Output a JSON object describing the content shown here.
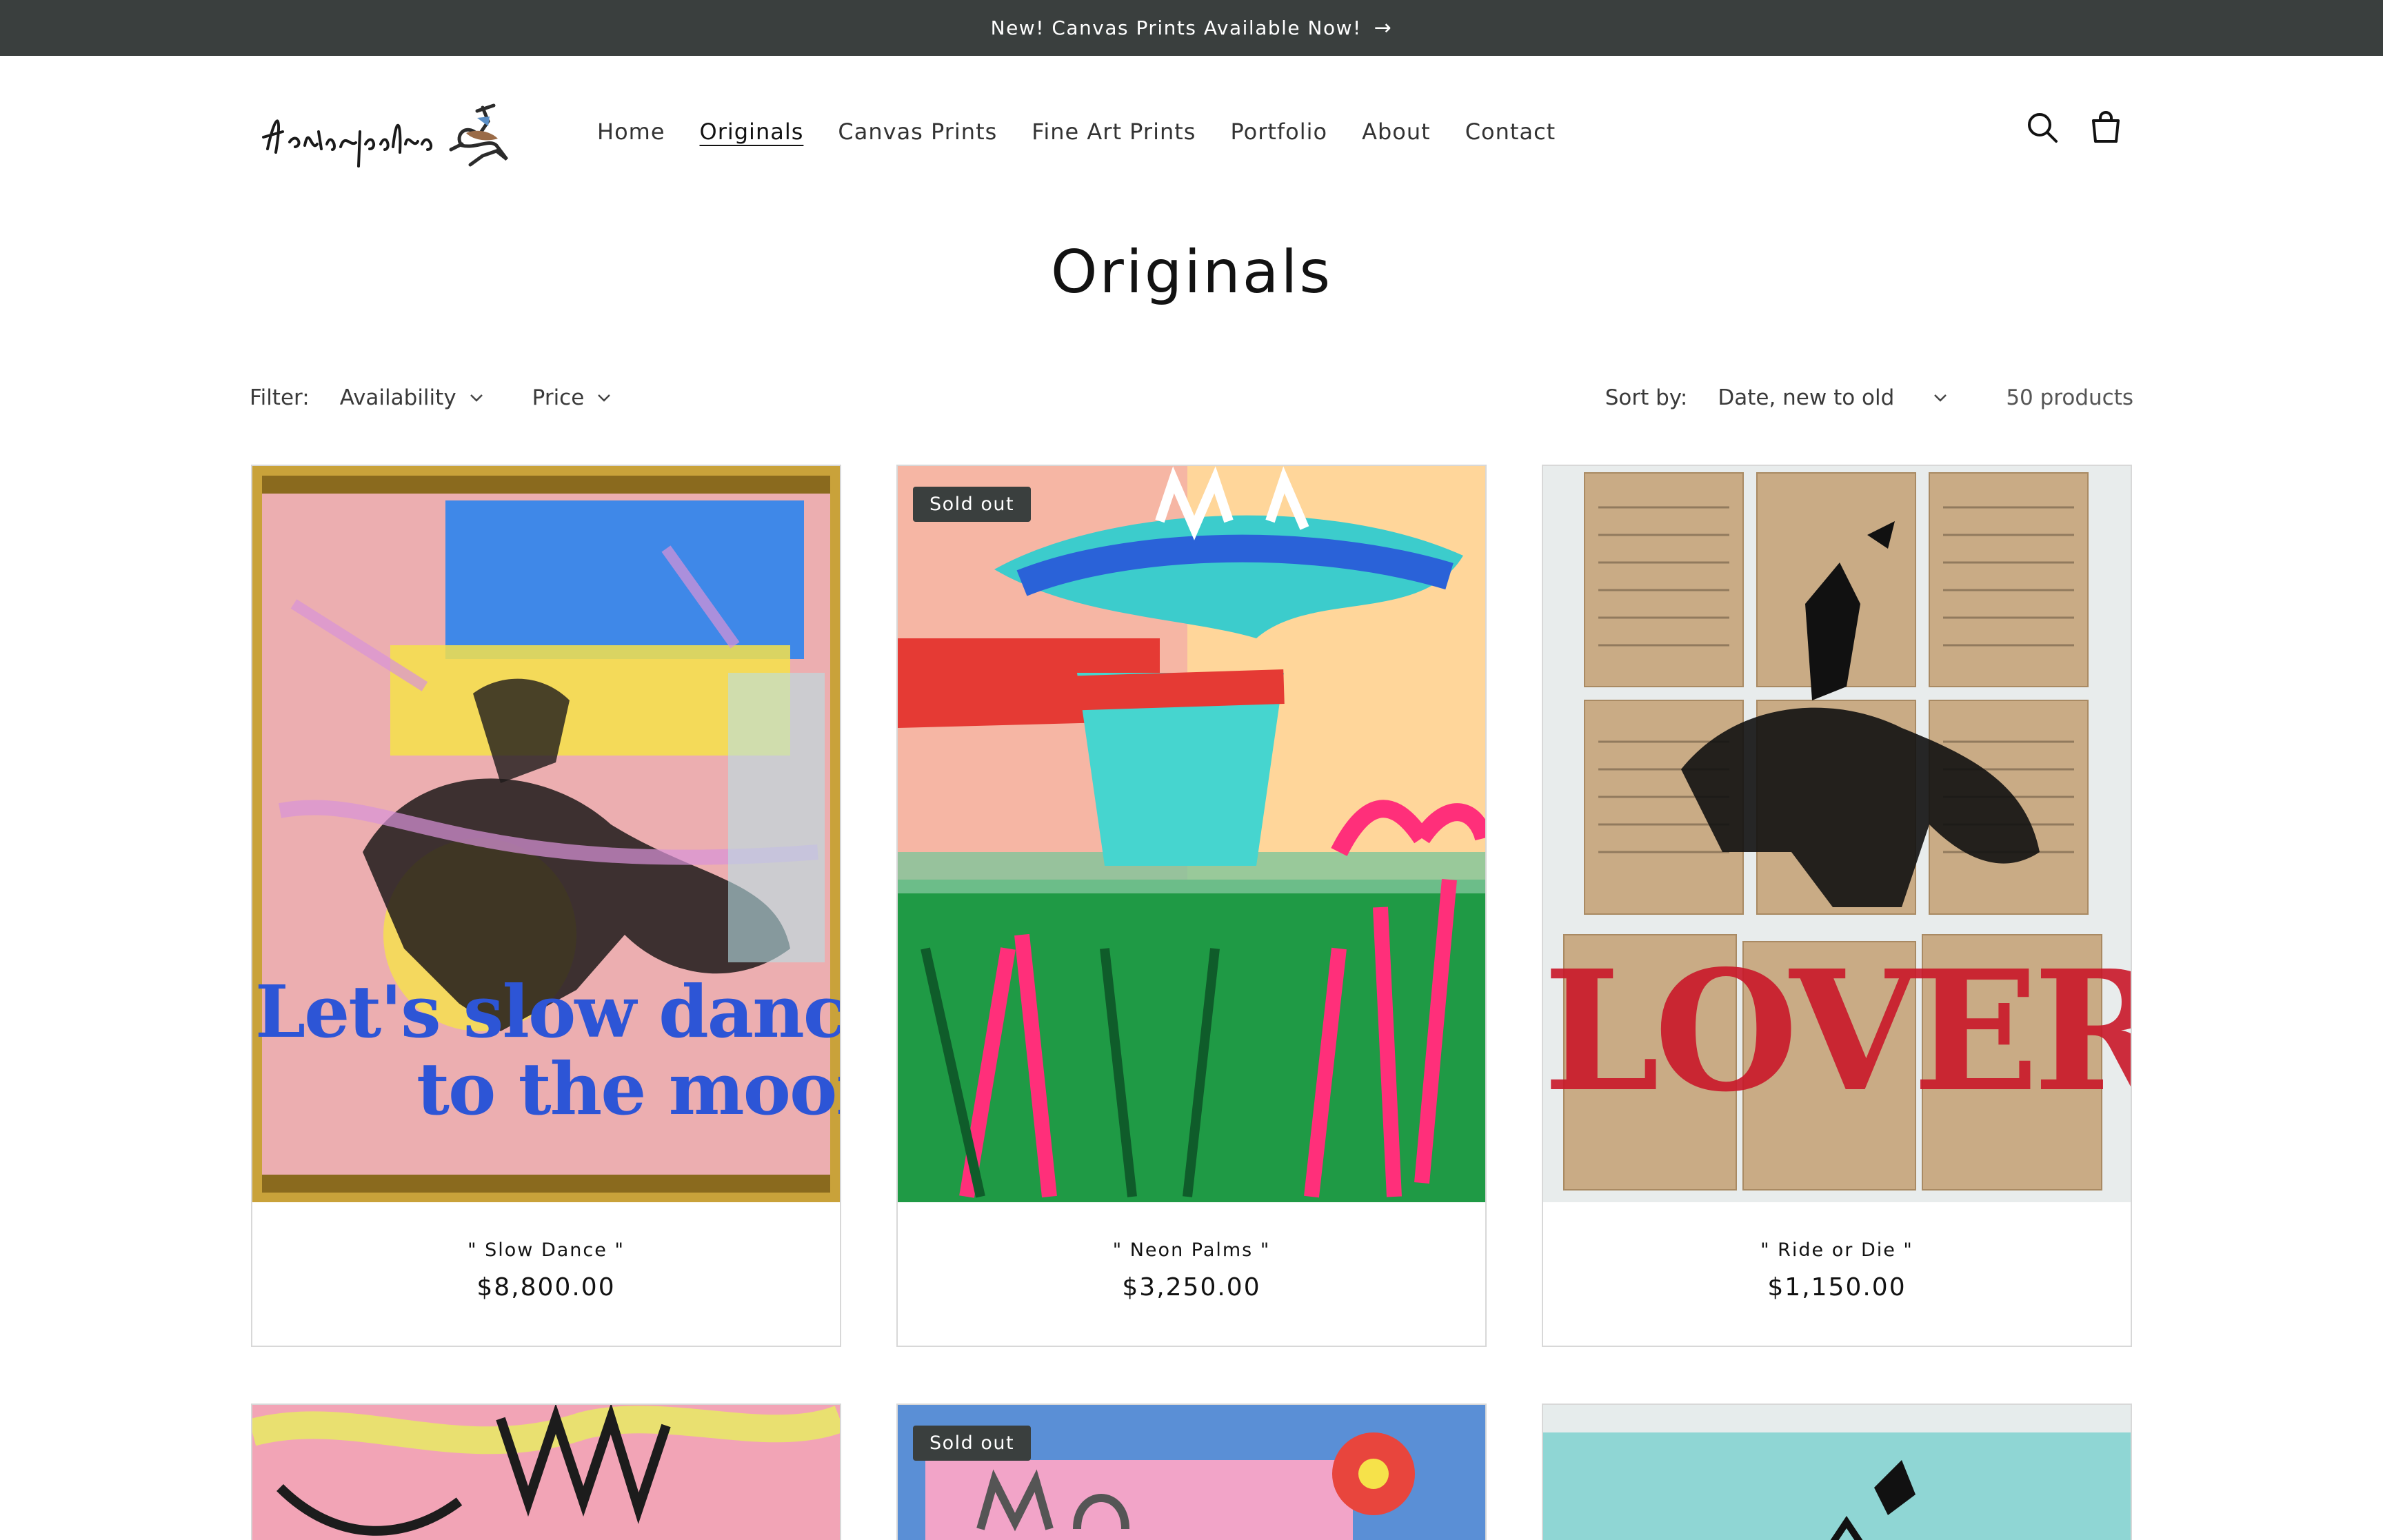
{
  "announcement": {
    "text": "New! Canvas Prints Available Now!",
    "arrow": "→"
  },
  "header": {
    "logo_alt": "Jakeypedro",
    "nav": [
      {
        "label": "Home"
      },
      {
        "label": "Originals",
        "active": true
      },
      {
        "label": "Canvas Prints"
      },
      {
        "label": "Fine Art Prints"
      },
      {
        "label": "Portfolio"
      },
      {
        "label": "About"
      },
      {
        "label": "Contact"
      }
    ],
    "icons": [
      "search-icon",
      "cart-icon"
    ]
  },
  "page": {
    "title": "Originals"
  },
  "filters": {
    "label": "Filter:",
    "availability": "Availability",
    "price": "Price",
    "sort_label": "Sort by:",
    "sort_value": "Date, new to old",
    "count": "50 products"
  },
  "products": [
    {
      "title": "\" Slow Dance \"",
      "price": "$8,800.00",
      "sold_out": false,
      "art_text": [
        "Let's slow dance",
        "to the moon."
      ]
    },
    {
      "title": "\" Neon Palms \"",
      "price": "$3,250.00",
      "sold_out": true,
      "badge": "Sold out"
    },
    {
      "title": "\" Ride or Die \"",
      "price": "$1,150.00",
      "sold_out": false,
      "art_text": [
        "LOVER"
      ]
    },
    {
      "sold_out": false
    },
    {
      "sold_out": true,
      "badge": "Sold out"
    },
    {
      "sold_out": false
    }
  ],
  "colors": {
    "announcement_bg": "#3a3f3e",
    "badge_bg": "#3a3f3e",
    "text": "#121212",
    "card_border": "#d8d8d8"
  }
}
